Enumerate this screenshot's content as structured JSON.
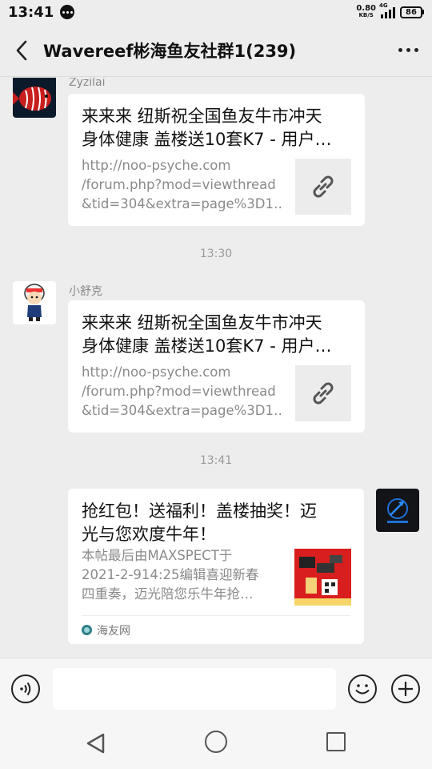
{
  "status_bar": {
    "time": "13:41",
    "net_speed_value": "0.80",
    "net_speed_unit": "KB/S",
    "network_type": "4G",
    "battery": "86"
  },
  "header": {
    "title": "Wavereef彬海鱼友社群1(239)",
    "back_icon": "chevron-left-icon",
    "more_icon": "more-dots-icon"
  },
  "messages": [
    {
      "sender": "Zyzilai",
      "title_lines": [
        "来来来 纽斯祝全国鱼友牛市冲天",
        "身体健康 盖楼送10套K7 - 用户…"
      ],
      "desc_lines": [
        "http://noo-psyche.com",
        "/forum.php?mod=viewthread",
        "&tid=304&extra=page%3D1…"
      ],
      "thumb_icon": "link-icon"
    },
    {
      "time": "13:30",
      "sender": "小舒克",
      "title_lines": [
        "来来来 纽斯祝全国鱼友牛市冲天",
        "身体健康 盖楼送10套K7 - 用户…"
      ],
      "desc_lines": [
        "http://noo-psyche.com",
        "/forum.php?mod=viewthread",
        "&tid=304&extra=page%3D1…"
      ],
      "thumb_icon": "link-icon"
    },
    {
      "time": "13:41",
      "title_lines": [
        "抢红包！送福利！盖楼抽奖！迈",
        "光与您欢度牛年！"
      ],
      "desc_lines": [
        "本帖最后由MAXSPECT于",
        "2021-2-914:25编辑喜迎新春",
        "四重奏，迈光陪您乐牛年抢…"
      ],
      "source": "海友网",
      "source_icon": "site-logo-icon"
    }
  ],
  "input_bar": {
    "voice_icon": "voice-icon",
    "input_value": "",
    "emoji_icon": "emoji-icon",
    "plus_icon": "plus-icon"
  },
  "nav_bar": {
    "back_icon": "nav-back-icon",
    "home_icon": "nav-home-icon",
    "recent_icon": "nav-recent-icon"
  },
  "colors": {
    "background": "#ededed",
    "card": "#ffffff",
    "red_envelope": "#d81e1e"
  }
}
